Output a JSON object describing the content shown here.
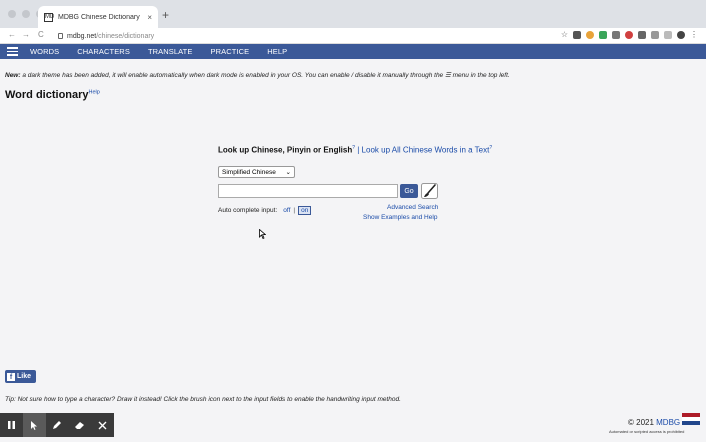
{
  "browser": {
    "tab_title": "MDBG Chinese Dictionary",
    "tab_favicon": "MD",
    "tab_close": "×",
    "new_tab": "+",
    "url_host": "mdbg.net",
    "url_path": "/chinese/dictionary",
    "back": "←",
    "forward": "→",
    "reload": "C",
    "star": "☆"
  },
  "nav": {
    "items": [
      "WORDS",
      "CHARACTERS",
      "TRANSLATE",
      "PRACTICE",
      "HELP"
    ]
  },
  "page": {
    "notice_bold": "New:",
    "notice_text": " a dark theme has been added, it will enable automatically when dark mode is enabled in your OS. You can enable / disable it manually through the ☰ menu in the top left.",
    "title": "Word dictionary",
    "title_help": "Help"
  },
  "lookup": {
    "heading": "Look up Chinese, Pinyin or English",
    "q1": "?",
    "sep": " | ",
    "link": "Look up All Chinese Words in a Text",
    "q2": "?",
    "select_value": "Simplified Chinese",
    "select_arrow": "⌄",
    "input_value": "",
    "go_label": "Go",
    "autocomplete_label": "Auto complete input:",
    "ac_off": "off",
    "ac_sep": "|",
    "ac_on": "on",
    "advanced": "Advanced Search",
    "examples": "Show Examples and Help"
  },
  "social": {
    "fb_icon": "f",
    "like": "Like"
  },
  "tip": "Tip: Not sure how to type a character? Draw it instead! Click the brush icon next to the input fields to enable the handwriting input method.",
  "footer": {
    "copy_prefix": "© 2021 ",
    "brand": "MDBG",
    "note": "Automated or scripted access is prohibited"
  },
  "recorder": {
    "icons": [
      "pause-icon",
      "pointer-icon",
      "pen-icon",
      "eraser-icon",
      "close-icon"
    ]
  },
  "colors": {
    "nav_bg": "#3b5998",
    "link": "#1a4ba8",
    "page_bg": "#f4f4f6"
  }
}
